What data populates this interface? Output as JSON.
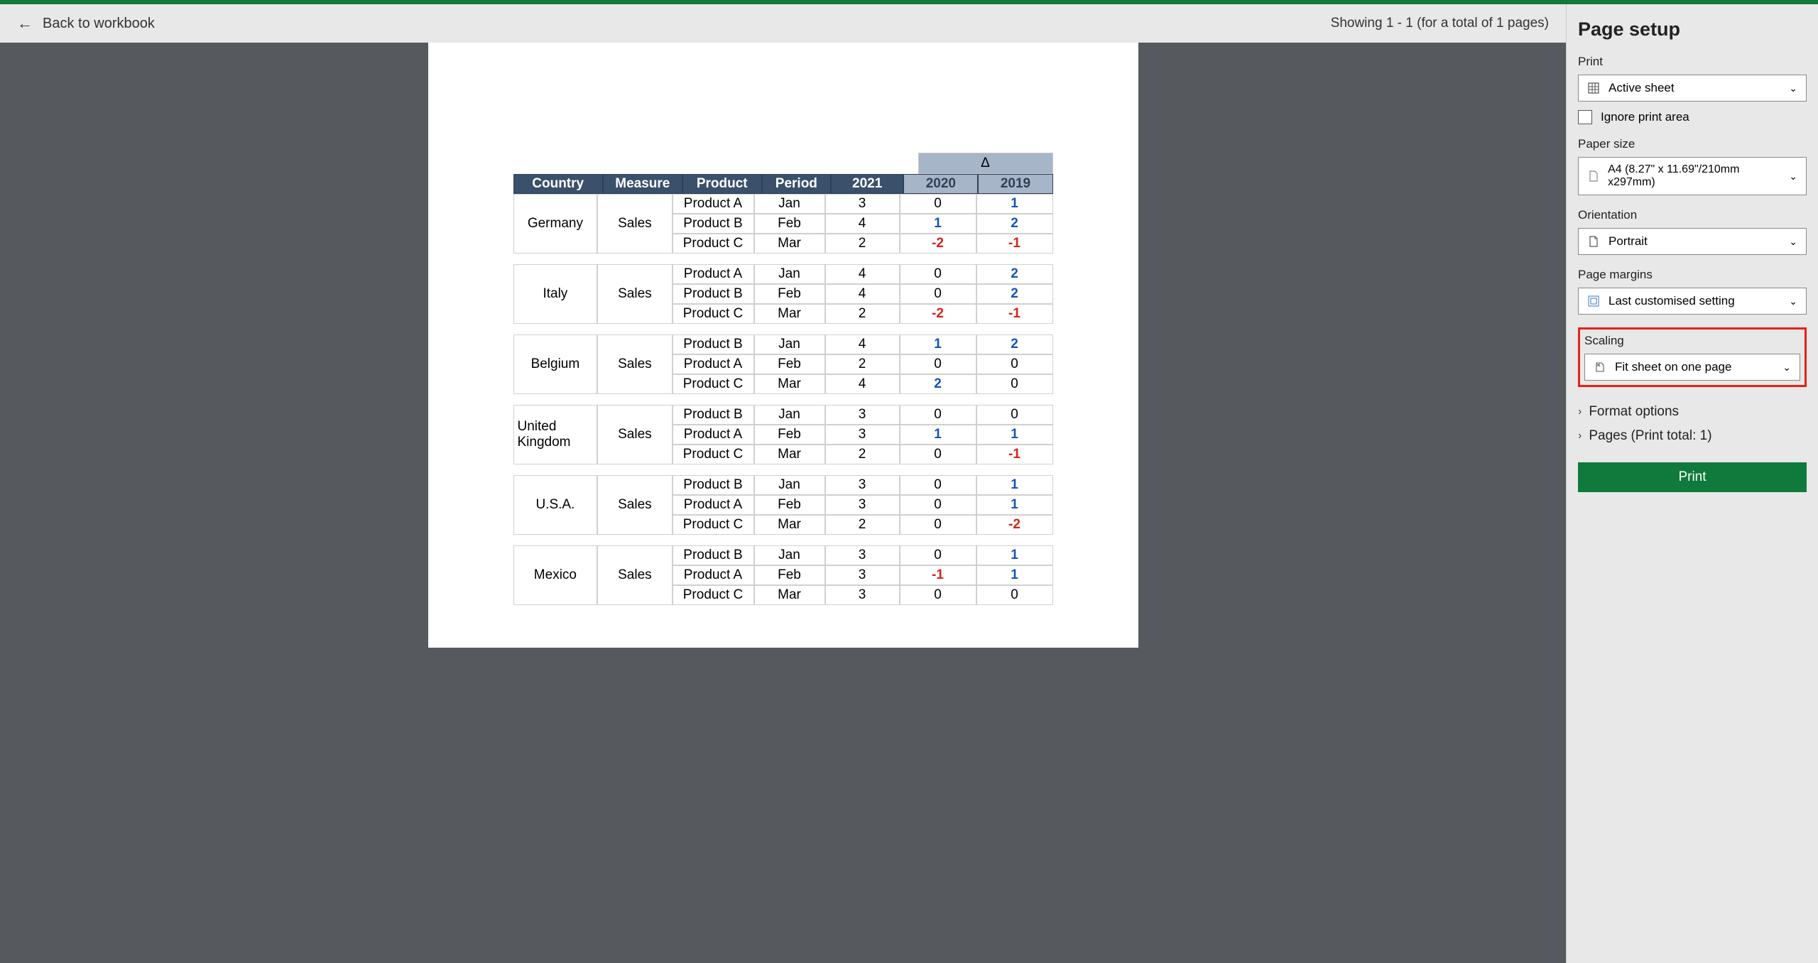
{
  "header": {
    "back_label": "Back to workbook",
    "showing_text": "Showing 1 - 1 (for a total of 1 pages)"
  },
  "table": {
    "delta_symbol": "Δ",
    "columns": [
      "Country",
      "Measure",
      "Product",
      "Period",
      "2021",
      "2020",
      "2019"
    ],
    "groups": [
      {
        "country": "Germany",
        "measure": "Sales",
        "rows": [
          {
            "product": "Product A",
            "period": "Jan",
            "y2021": "3",
            "y2020": "0",
            "y2019": "1",
            "y2020_style": "",
            "y2019_style": "blue bold"
          },
          {
            "product": "Product B",
            "period": "Feb",
            "y2021": "4",
            "y2020": "1",
            "y2019": "2",
            "y2020_style": "blue bold",
            "y2019_style": "blue bold"
          },
          {
            "product": "Product C",
            "period": "Mar",
            "y2021": "2",
            "y2020": "-2",
            "y2019": "-1",
            "y2020_style": "red bold",
            "y2019_style": "red bold"
          }
        ]
      },
      {
        "country": "Italy",
        "measure": "Sales",
        "rows": [
          {
            "product": "Product A",
            "period": "Jan",
            "y2021": "4",
            "y2020": "0",
            "y2019": "2",
            "y2020_style": "",
            "y2019_style": "blue bold"
          },
          {
            "product": "Product B",
            "period": "Feb",
            "y2021": "4",
            "y2020": "0",
            "y2019": "2",
            "y2020_style": "",
            "y2019_style": "blue bold"
          },
          {
            "product": "Product C",
            "period": "Mar",
            "y2021": "2",
            "y2020": "-2",
            "y2019": "-1",
            "y2020_style": "red bold",
            "y2019_style": "red bold"
          }
        ]
      },
      {
        "country": "Belgium",
        "measure": "Sales",
        "rows": [
          {
            "product": "Product B",
            "period": "Jan",
            "y2021": "4",
            "y2020": "1",
            "y2019": "2",
            "y2020_style": "blue bold",
            "y2019_style": "blue bold"
          },
          {
            "product": "Product A",
            "period": "Feb",
            "y2021": "2",
            "y2020": "0",
            "y2019": "0",
            "y2020_style": "",
            "y2019_style": ""
          },
          {
            "product": "Product C",
            "period": "Mar",
            "y2021": "4",
            "y2020": "2",
            "y2019": "0",
            "y2020_style": "blue bold",
            "y2019_style": ""
          }
        ]
      },
      {
        "country": "United Kingdom",
        "measure": "Sales",
        "rows": [
          {
            "product": "Product B",
            "period": "Jan",
            "y2021": "3",
            "y2020": "0",
            "y2019": "0",
            "y2020_style": "",
            "y2019_style": ""
          },
          {
            "product": "Product A",
            "period": "Feb",
            "y2021": "3",
            "y2020": "1",
            "y2019": "1",
            "y2020_style": "blue bold",
            "y2019_style": "blue bold"
          },
          {
            "product": "Product C",
            "period": "Mar",
            "y2021": "2",
            "y2020": "0",
            "y2019": "-1",
            "y2020_style": "",
            "y2019_style": "red bold"
          }
        ]
      },
      {
        "country": "U.S.A.",
        "measure": "Sales",
        "rows": [
          {
            "product": "Product B",
            "period": "Jan",
            "y2021": "3",
            "y2020": "0",
            "y2019": "1",
            "y2020_style": "",
            "y2019_style": "blue bold"
          },
          {
            "product": "Product A",
            "period": "Feb",
            "y2021": "3",
            "y2020": "0",
            "y2019": "1",
            "y2020_style": "",
            "y2019_style": "blue bold"
          },
          {
            "product": "Product C",
            "period": "Mar",
            "y2021": "2",
            "y2020": "0",
            "y2019": "-2",
            "y2020_style": "",
            "y2019_style": "red bold"
          }
        ]
      },
      {
        "country": "Mexico",
        "measure": "Sales",
        "rows": [
          {
            "product": "Product B",
            "period": "Jan",
            "y2021": "3",
            "y2020": "0",
            "y2019": "1",
            "y2020_style": "",
            "y2019_style": "blue bold"
          },
          {
            "product": "Product A",
            "period": "Feb",
            "y2021": "3",
            "y2020": "-1",
            "y2019": "1",
            "y2020_style": "red bold",
            "y2019_style": "blue bold"
          },
          {
            "product": "Product C",
            "period": "Mar",
            "y2021": "3",
            "y2020": "0",
            "y2019": "0",
            "y2020_style": "",
            "y2019_style": ""
          }
        ]
      }
    ]
  },
  "panel": {
    "title": "Page setup",
    "print_label": "Print",
    "print_value": "Active sheet",
    "ignore_print_area_label": "Ignore print area",
    "paper_size_label": "Paper size",
    "paper_size_value": "A4 (8.27\" x 11.69\"/210mm x297mm)",
    "orientation_label": "Orientation",
    "orientation_value": "Portrait",
    "margins_label": "Page margins",
    "margins_value": "Last customised setting",
    "scaling_label": "Scaling",
    "scaling_value": "Fit sheet on one page",
    "format_options_label": "Format options",
    "pages_label": "Pages (Print total: 1)",
    "print_button_label": "Print"
  }
}
